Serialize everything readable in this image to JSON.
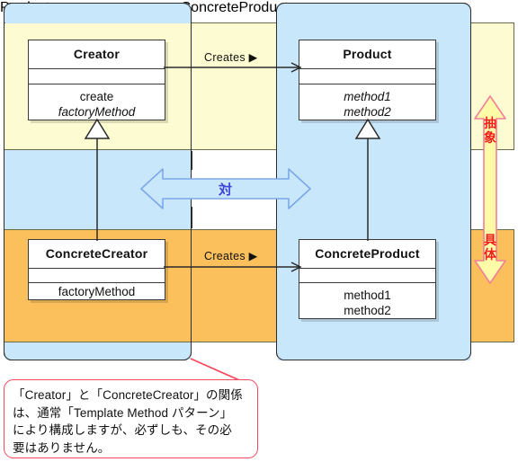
{
  "diagram": {
    "title": "Factory Method pattern class diagram",
    "layers": {
      "abstract_label": "抽象",
      "concrete_label": "具体"
    },
    "relation_label": "対",
    "colors": {
      "abstract_band": "#fdfbd2",
      "concrete_band": "#fbbf5c",
      "package_column": "#c9e7fb",
      "relation_arrow": "#c9e7fb",
      "relation_arrow_stroke": "#7ba7e8",
      "layer_arrow_fill": "#fdfbA8",
      "layer_arrow_stroke": "#f08098",
      "layer_text": "#ef1d1d",
      "relation_text": "#3a44d8",
      "callout_border": "#f4485c"
    },
    "classes": [
      {
        "id": "creator",
        "name": "Creator",
        "attributes": [],
        "operations": [
          {
            "text": "create",
            "abstract": false
          },
          {
            "text": "factoryMethod",
            "abstract": true
          }
        ]
      },
      {
        "id": "product",
        "name": "Product",
        "attributes": [],
        "operations": [
          {
            "text": "method1",
            "abstract": true
          },
          {
            "text": "method2",
            "abstract": true
          }
        ]
      },
      {
        "id": "concrete-creator",
        "name": "ConcreteCreator",
        "attributes": [],
        "operations": [
          {
            "text": "factoryMethod",
            "abstract": false
          }
        ]
      },
      {
        "id": "concrete-product",
        "name": "ConcreteProduct",
        "attributes": [],
        "operations": [
          {
            "text": "method1",
            "abstract": false
          },
          {
            "text": "method2",
            "abstract": false
          }
        ]
      }
    ],
    "associations": [
      {
        "id": "creator-creates-product",
        "label": "Creates ▶"
      },
      {
        "id": "concrete-creator-creates-concrete-product",
        "label": "Creates ▶"
      }
    ],
    "callout": {
      "text": "「Creator」と「ConcreteCreator」の関係\nは、通常「Template Method パターン」\nにより構成しますが、必ずしも、その必\n要はありません。"
    }
  }
}
